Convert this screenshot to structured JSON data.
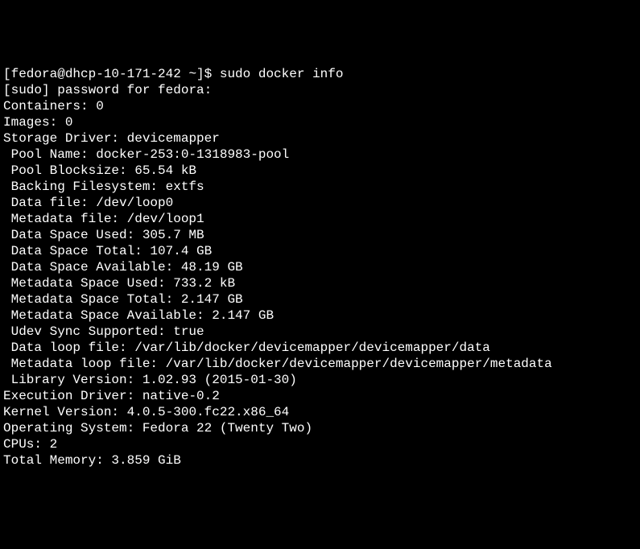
{
  "terminal": {
    "prompt_line": "[fedora@dhcp-10-171-242 ~]$ sudo docker info",
    "sudo_prompt": "[sudo] password for fedora:",
    "lines": [
      {
        "text": "Containers: 0",
        "indent": false
      },
      {
        "text": "Images: 0",
        "indent": false
      },
      {
        "text": "Storage Driver: devicemapper",
        "indent": false
      },
      {
        "text": "Pool Name: docker-253:0-1318983-pool",
        "indent": true
      },
      {
        "text": "Pool Blocksize: 65.54 kB",
        "indent": true
      },
      {
        "text": "Backing Filesystem: extfs",
        "indent": true
      },
      {
        "text": "Data file: /dev/loop0",
        "indent": true
      },
      {
        "text": "Metadata file: /dev/loop1",
        "indent": true
      },
      {
        "text": "Data Space Used: 305.7 MB",
        "indent": true
      },
      {
        "text": "Data Space Total: 107.4 GB",
        "indent": true
      },
      {
        "text": "Data Space Available: 48.19 GB",
        "indent": true
      },
      {
        "text": "Metadata Space Used: 733.2 kB",
        "indent": true
      },
      {
        "text": "Metadata Space Total: 2.147 GB",
        "indent": true
      },
      {
        "text": "Metadata Space Available: 2.147 GB",
        "indent": true
      },
      {
        "text": "Udev Sync Supported: true",
        "indent": true
      },
      {
        "text": "Data loop file: /var/lib/docker/devicemapper/devicemapper/data",
        "indent": true
      },
      {
        "text": "Metadata loop file: /var/lib/docker/devicemapper/devicemapper/metadata",
        "indent": true
      },
      {
        "text": "Library Version: 1.02.93 (2015-01-30)",
        "indent": true
      },
      {
        "text": "Execution Driver: native-0.2",
        "indent": false
      },
      {
        "text": "Kernel Version: 4.0.5-300.fc22.x86_64",
        "indent": false
      },
      {
        "text": "Operating System: Fedora 22 (Twenty Two)",
        "indent": false
      },
      {
        "text": "CPUs: 2",
        "indent": false
      },
      {
        "text": "Total Memory: 3.859 GiB",
        "indent": false
      }
    ]
  }
}
